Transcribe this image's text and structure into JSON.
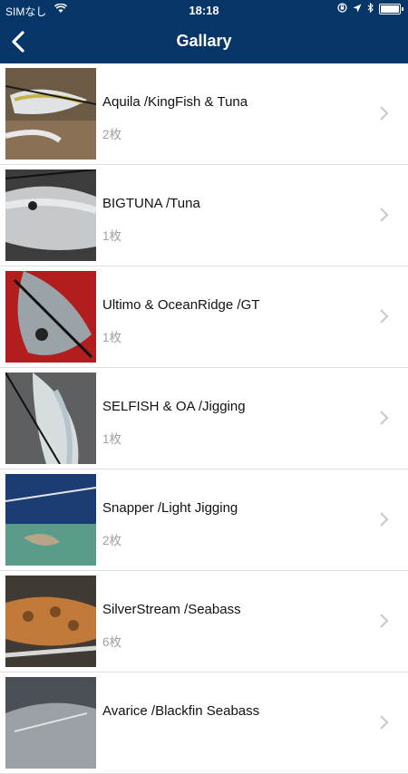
{
  "status_bar": {
    "carrier": "SIMなし",
    "time": "18:18"
  },
  "nav": {
    "back_icon": "chevron-left-icon",
    "title": "Gallary"
  },
  "colors": {
    "nav_background": "#063567",
    "separator": "#dddddd",
    "count_text": "#a0a0a0",
    "chevron": "#c7c7cc"
  },
  "gallery": [
    {
      "name": "Aquila /KingFish & Tuna",
      "count": "2枚"
    },
    {
      "name": "BIGTUNA /Tuna",
      "count": "1枚"
    },
    {
      "name": "Ultimo & OceanRidge /GT",
      "count": "1枚"
    },
    {
      "name": "SELFISH & OA /Jigging",
      "count": "1枚"
    },
    {
      "name": "Snapper /Light Jigging",
      "count": "2枚"
    },
    {
      "name": "SilverStream /Seabass",
      "count": "6枚"
    },
    {
      "name": "Avarice /Blackfin Seabass",
      "count": ""
    }
  ]
}
